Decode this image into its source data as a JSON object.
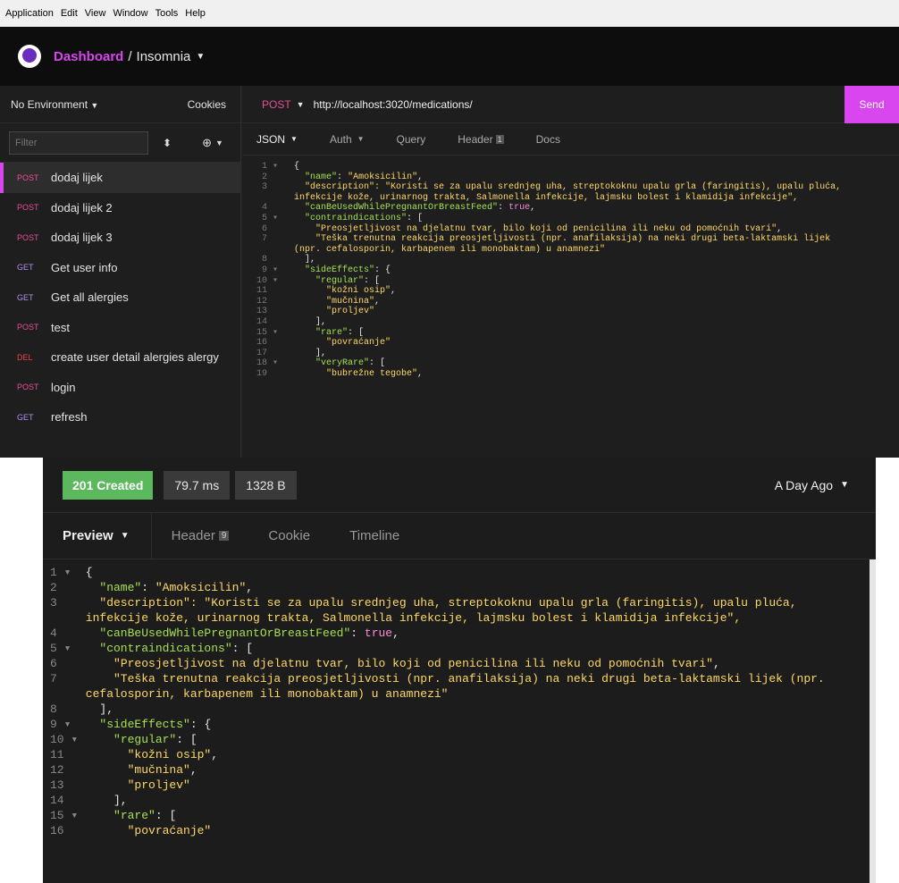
{
  "menubar": [
    "Application",
    "Edit",
    "View",
    "Window",
    "Tools",
    "Help"
  ],
  "title": {
    "dashboard": "Dashboard",
    "separator": "/",
    "workspace": "Insomnia"
  },
  "sidebar": {
    "environment": "No Environment",
    "cookies": "Cookies",
    "filter_placeholder": "Filter",
    "requests": [
      {
        "method": "POST",
        "name": "dodaj lijek"
      },
      {
        "method": "POST",
        "name": "dodaj lijek 2"
      },
      {
        "method": "POST",
        "name": "dodaj lijek 3"
      },
      {
        "method": "GET",
        "name": "Get user info"
      },
      {
        "method": "GET",
        "name": "Get all alergies"
      },
      {
        "method": "POST",
        "name": "test"
      },
      {
        "method": "DEL",
        "name": "create user detail alergies alergy"
      },
      {
        "method": "POST",
        "name": "login"
      },
      {
        "method": "GET",
        "name": "refresh"
      }
    ]
  },
  "request": {
    "method": "POST",
    "url": "http://localhost:3020/medications/",
    "send_label": "Send",
    "tabs": {
      "body": "JSON",
      "auth": "Auth",
      "query": "Query",
      "header": "Header",
      "header_count": "1",
      "docs": "Docs"
    }
  },
  "request_code": [
    {
      "n": "1",
      "f": "▾",
      "t": "{"
    },
    {
      "n": "2",
      "f": "",
      "t": "  \"name\": \"Amoksicilin\","
    },
    {
      "n": "3",
      "f": "",
      "t": "  \"description\": \"Koristi se za upalu srednjeg uha, streptokoknu upalu grla (faringitis), upalu pluća,"
    },
    {
      "n": "",
      "f": "",
      "t": "infekcije kože, urinarnog trakta, Salmonella infekcije, lajmsku bolest i klamidija infekcije\","
    },
    {
      "n": "4",
      "f": "",
      "t": "  \"canBeUsedWhilePregnantOrBreastFeed\": true,"
    },
    {
      "n": "5",
      "f": "▾",
      "t": "  \"contraindications\": ["
    },
    {
      "n": "6",
      "f": "",
      "t": "    \"Preosjetljivost na djelatnu tvar, bilo koji od penicilina ili neku od pomoćnih tvari\","
    },
    {
      "n": "7",
      "f": "",
      "t": "    \"Teška trenutna reakcija preosjetljivosti (npr. anafilaksija) na neki drugi beta-laktamski lijek"
    },
    {
      "n": "",
      "f": "",
      "t": "(npr. cefalosporin, karbapenem ili monobaktam) u anamnezi\""
    },
    {
      "n": "8",
      "f": "",
      "t": "  ],"
    },
    {
      "n": "9",
      "f": "▾",
      "t": "  \"sideEffects\": {"
    },
    {
      "n": "10",
      "f": "▾",
      "t": "    \"regular\": ["
    },
    {
      "n": "11",
      "f": "",
      "t": "      \"kožni osip\","
    },
    {
      "n": "12",
      "f": "",
      "t": "      \"mučnina\","
    },
    {
      "n": "13",
      "f": "",
      "t": "      \"proljev\""
    },
    {
      "n": "14",
      "f": "",
      "t": "    ],"
    },
    {
      "n": "15",
      "f": "▾",
      "t": "    \"rare\": ["
    },
    {
      "n": "16",
      "f": "",
      "t": "      \"povraćanje\""
    },
    {
      "n": "17",
      "f": "",
      "t": "    ],"
    },
    {
      "n": "18",
      "f": "▾",
      "t": "    \"veryRare\": ["
    },
    {
      "n": "19",
      "f": "",
      "t": "      \"bubrežne tegobe\","
    }
  ],
  "response": {
    "status": "201 Created",
    "time": "79.7 ms",
    "size": "1328 B",
    "ago": "A Day Ago",
    "tabs": {
      "preview": "Preview",
      "header": "Header",
      "header_count": "9",
      "cookie": "Cookie",
      "timeline": "Timeline"
    }
  },
  "response_code": [
    {
      "n": "1 ▾",
      "t": "{"
    },
    {
      "n": "2",
      "t": "  \"name\": \"Amoksicilin\","
    },
    {
      "n": "3",
      "t": "  \"description\": \"Koristi se za upalu srednjeg uha, streptokoknu upalu grla (faringitis), upalu pluća,"
    },
    {
      "n": "",
      "t": "infekcije kože, urinarnog trakta, Salmonella infekcije, lajmsku bolest i klamidija infekcije\","
    },
    {
      "n": "4",
      "t": "  \"canBeUsedWhilePregnantOrBreastFeed\": true,"
    },
    {
      "n": "5 ▾",
      "t": "  \"contraindications\": ["
    },
    {
      "n": "6",
      "t": "    \"Preosjetljivost na djelatnu tvar, bilo koji od penicilina ili neku od pomoćnih tvari\","
    },
    {
      "n": "7",
      "t": "    \"Teška trenutna reakcija preosjetljivosti (npr. anafilaksija) na neki drugi beta-laktamski lijek (npr."
    },
    {
      "n": "",
      "t": "cefalosporin, karbapenem ili monobaktam) u anamnezi\""
    },
    {
      "n": "8",
      "t": "  ],"
    },
    {
      "n": "9 ▾",
      "t": "  \"sideEffects\": {"
    },
    {
      "n": "10 ▾",
      "t": "    \"regular\": ["
    },
    {
      "n": "11",
      "t": "      \"kožni osip\","
    },
    {
      "n": "12",
      "t": "      \"mučnina\","
    },
    {
      "n": "13",
      "t": "      \"proljev\""
    },
    {
      "n": "14",
      "t": "    ],"
    },
    {
      "n": "15 ▾",
      "t": "    \"rare\": ["
    },
    {
      "n": "16",
      "t": "      \"povraćanje\""
    }
  ],
  "colors": {
    "accent": "#d946ef",
    "success": "#5cb85c",
    "json_key": "#a5e052",
    "json_string": "#ffd966",
    "json_bool": "#ff8ad8"
  }
}
